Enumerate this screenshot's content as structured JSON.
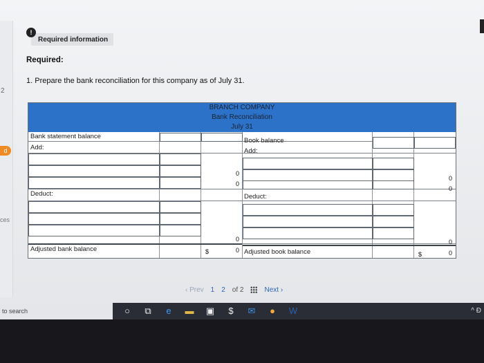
{
  "header": {
    "info_icon": "!",
    "info_label": "Required information",
    "required_title": "Required:",
    "instruction": "1. Prepare the bank reconciliation for this company as of July 31."
  },
  "sidebar": {
    "step_number": "2",
    "badge": "d",
    "label": "ces"
  },
  "recon": {
    "company": "BRANCH COMPANY",
    "title": "Bank Reconciliation",
    "date": "July 31",
    "bank": {
      "statement_label": "Bank statement balance",
      "add_label": "Add:",
      "deduct_label": "Deduct:",
      "adjusted_label": "Adjusted bank balance",
      "add_total": "0",
      "deduct_total": "0",
      "adjusted_currency": "$",
      "adjusted_value": "0"
    },
    "book": {
      "balance_label": "Book balance",
      "add_label": "Add:",
      "deduct_label": "Deduct:",
      "adjusted_label": "Adjusted book balance",
      "add_total": "0",
      "deduct_total": "0",
      "adjusted_currency": "$",
      "adjusted_value": "0"
    }
  },
  "pager": {
    "prev_label": "Prev",
    "current_page": "1",
    "next_page": "2",
    "of_label": "of 2",
    "next_label": "Next"
  },
  "taskbar": {
    "search_placeholder": "to search",
    "tray_text": "^ Ɖ"
  }
}
